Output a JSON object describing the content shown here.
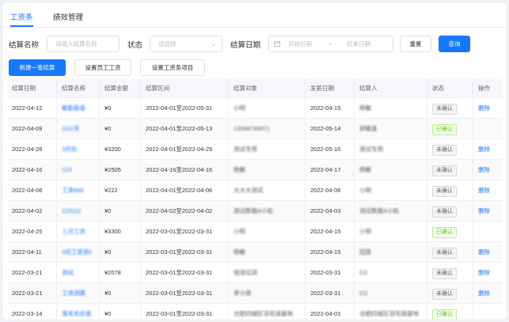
{
  "tabs": [
    {
      "label": "工资条",
      "active": true
    },
    {
      "label": "绩效管理",
      "active": false
    }
  ],
  "filters": {
    "settlement_name_label": "结算名称",
    "settlement_name_placeholder": "请输入结算名称",
    "status_label": "状态",
    "status_placeholder": "请选择",
    "settlement_date_label": "结算日期",
    "start_date_placeholder": "开始日期",
    "date_separator": "-",
    "end_date_placeholder": "结束日期",
    "reset_label": "重置",
    "search_label": "查询"
  },
  "actions": {
    "new_settlement": "新建一笔结算",
    "set_staff_salary": "设置员工工资",
    "set_salary_items": "设置工资条项目"
  },
  "table": {
    "columns": [
      "结算日期",
      "结算名称",
      "结算金额",
      "结算区间",
      "结算对象",
      "发薪日期",
      "结算人",
      "状态",
      "操作"
    ],
    "delete_label": "删除",
    "rows": [
      {
        "date": "2022-04-12",
        "name": "敏勤嘉嘉",
        "amount": "¥0",
        "range": "2022-04-01至2022-05-31",
        "target": "小明",
        "pay_date": "2022-04-15",
        "person": "杨敏",
        "status": "未确认",
        "confirmed": false,
        "can_delete": true
      },
      {
        "date": "2022-04-09",
        "name": "1111天",
        "amount": "¥0",
        "range": "2022-04-01至2022-05-13",
        "target": "13398740071",
        "pay_date": "2022-05-14",
        "person": "邱敏嘉",
        "status": "已确认",
        "confirmed": true,
        "can_delete": false
      },
      {
        "date": "2022-04-26",
        "name": "3月份",
        "amount": "¥3200",
        "range": "2022-04-01至2022-04-29",
        "target": "测试专用",
        "pay_date": "2022-05-10",
        "person": "测试专用",
        "status": "未确认",
        "confirmed": false,
        "can_delete": true
      },
      {
        "date": "2022-04-16",
        "name": "123",
        "amount": "¥2505",
        "range": "2022-04-16至2022-04-16",
        "target": "杨敏",
        "pay_date": "2022-04-17",
        "person": "杨敏",
        "status": "未确认",
        "confirmed": false,
        "can_delete": true
      },
      {
        "date": "2022-04-06",
        "name": "工资666",
        "amount": "¥222",
        "range": "2022-04-01至2022-04-06",
        "target": "大大大测试",
        "pay_date": "2022-04-06",
        "person": "小明",
        "status": "未确认",
        "confirmed": false,
        "can_delete": true
      },
      {
        "date": "2022-04-02",
        "name": "123112",
        "amount": "¥0",
        "range": "2022-04-02至2022-04-02",
        "target": "测试数据A小松",
        "pay_date": "2022-04-03",
        "person": "测试数据A小松",
        "status": "未确认",
        "confirmed": false,
        "can_delete": true
      },
      {
        "date": "2022-04-25",
        "name": "三月工资",
        "amount": "¥3300",
        "range": "2022-03-01至2022-03-31",
        "target": "小明",
        "pay_date": "2022-04-15",
        "person": "小明",
        "status": "已确认",
        "confirmed": true,
        "can_delete": false
      },
      {
        "date": "2022-04-11",
        "name": "3月工资测1",
        "amount": "¥0",
        "range": "2022-03-01至2022-03-31",
        "target": "杨敏",
        "pay_date": "2022-04-15",
        "person": "冠霖",
        "status": "未确认",
        "confirmed": false,
        "can_delete": true
      },
      {
        "date": "2022-03-21",
        "name": "测试",
        "amount": "¥2078",
        "range": "2022-03-01至2022-03-31",
        "target": "钱测试测",
        "pay_date": "2022-03-31",
        "person": "CC",
        "status": "未确认",
        "confirmed": false,
        "can_delete": true
      },
      {
        "date": "2022-03-21",
        "name": "工资测算",
        "amount": "¥0",
        "range": "2022-03-01至2022-03-31",
        "target": "李小侠",
        "pay_date": "2022-03-31",
        "person": "CC",
        "status": "未确认",
        "confirmed": false,
        "can_delete": true
      },
      {
        "date": "2022-03-14",
        "name": "落毛毛优差",
        "amount": "¥0",
        "range": "2022-03-01至2022-03-31",
        "target": "合肥四城区羽毛球基地",
        "pay_date": "2022-04-01",
        "person": "合肥四城区羽毛球基地",
        "status": "已确认",
        "confirmed": true,
        "can_delete": false
      }
    ]
  }
}
